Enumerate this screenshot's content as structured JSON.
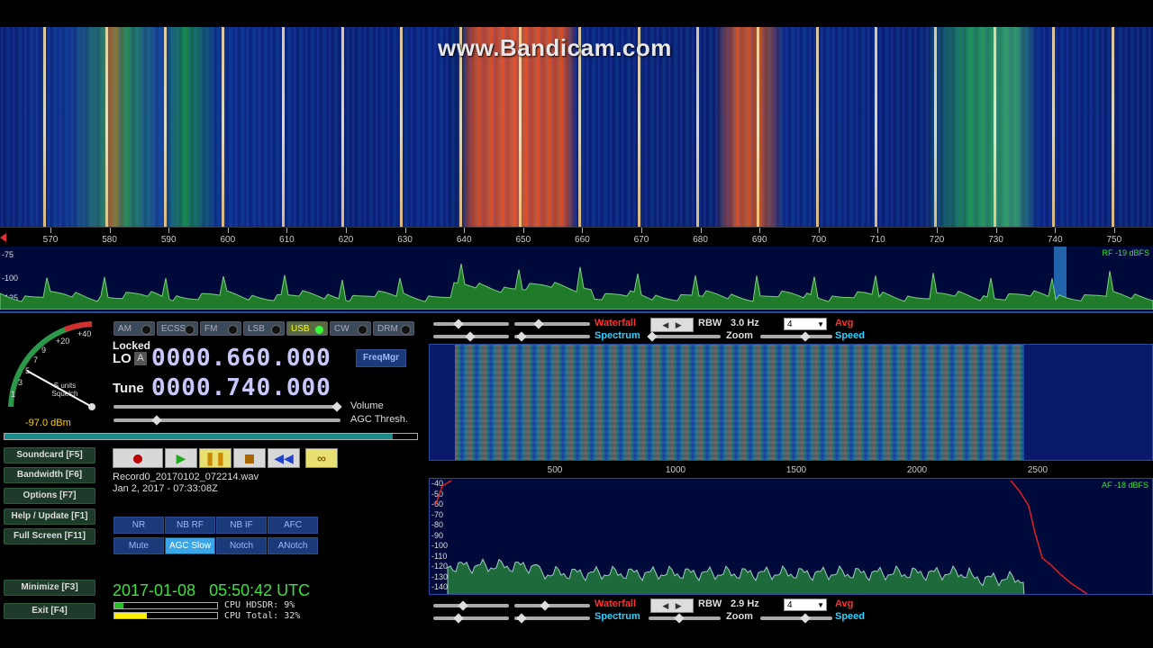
{
  "watermark": "www.Bandicam.com",
  "rf_axis": {
    "labels": [
      "570",
      "580",
      "590",
      "600",
      "610",
      "620",
      "630",
      "640",
      "650",
      "660",
      "670",
      "680",
      "690",
      "700",
      "710",
      "720",
      "730",
      "740",
      "750"
    ]
  },
  "rf_spectrum": {
    "db_labels": [
      "-75",
      "-100",
      "-125"
    ],
    "level": "RF -19 dBFS"
  },
  "smeter": {
    "scale": [
      "+40",
      "+20",
      "9",
      "7",
      "5",
      "3",
      "1"
    ],
    "squelch_label": "S units Squelch",
    "reading": "-97.0 dBm"
  },
  "modes": [
    {
      "label": "AM",
      "active": false
    },
    {
      "label": "ECSS",
      "active": false
    },
    {
      "label": "FM",
      "active": false
    },
    {
      "label": "LSB",
      "active": false
    },
    {
      "label": "USB",
      "active": true
    },
    {
      "label": "CW",
      "active": false
    },
    {
      "label": "DRM",
      "active": false
    }
  ],
  "lo": {
    "locked": "Locked",
    "label": "LO",
    "a": "A",
    "value": "0000.660.000",
    "freqmgr": "FreqMgr"
  },
  "tune": {
    "label": "Tune",
    "value": "0000.740.000"
  },
  "volume_label": "Volume",
  "agc_thresh_label": "AGC Thresh.",
  "side_buttons": {
    "soundcard": "Soundcard [F5]",
    "bandwidth": "Bandwidth [F6]",
    "options": "Options [F7]",
    "help": "Help / Update [F1]",
    "fullscreen": "Full Screen [F11]",
    "minimize": "Minimize [F3]",
    "exit": "Exit [F4]"
  },
  "recording": {
    "filename": "Record0_20170102_072214.wav",
    "timestamp": "Jan 2, 2017 - 07:33:08Z"
  },
  "dsp": {
    "nr": "NR",
    "nbrf": "NB RF",
    "nbif": "NB IF",
    "afc": "AFC",
    "mute": "Mute",
    "agc": "AGC Slow",
    "notch": "Notch",
    "anotch": "ANotch"
  },
  "clock": "2017-01-08   05:50:42 UTC",
  "cpu": {
    "hdsdr": "CPU HDSDR: 9%",
    "total": "CPU Total: 32%",
    "hdsdr_pct": 9,
    "total_pct": 32
  },
  "rf_controls": {
    "waterfall": "Waterfall",
    "spectrum": "Spectrum",
    "rbw_label": "RBW",
    "rbw_value": "3.0 Hz",
    "zoom": "Zoom",
    "avg": "Avg",
    "speed": "Speed",
    "avg_value": "4"
  },
  "af_controls": {
    "waterfall": "Waterfall",
    "spectrum": "Spectrum",
    "rbw_label": "RBW",
    "rbw_value": "2.9 Hz",
    "zoom": "Zoom",
    "avg": "Avg",
    "speed": "Speed",
    "avg_value": "4"
  },
  "af_axis": {
    "labels": [
      "500",
      "1000",
      "1500",
      "2000",
      "2500"
    ]
  },
  "af_spectrum": {
    "db_labels": [
      "-40",
      "-50",
      "-60",
      "-70",
      "-80",
      "-90",
      "-100",
      "-110",
      "-120",
      "-130",
      "-140"
    ],
    "level": "AF -18 dBFS"
  },
  "colors": {
    "accent_red": "#ff3030",
    "accent_cyan": "#30d0ff",
    "clock_green": "#3ee03e"
  }
}
